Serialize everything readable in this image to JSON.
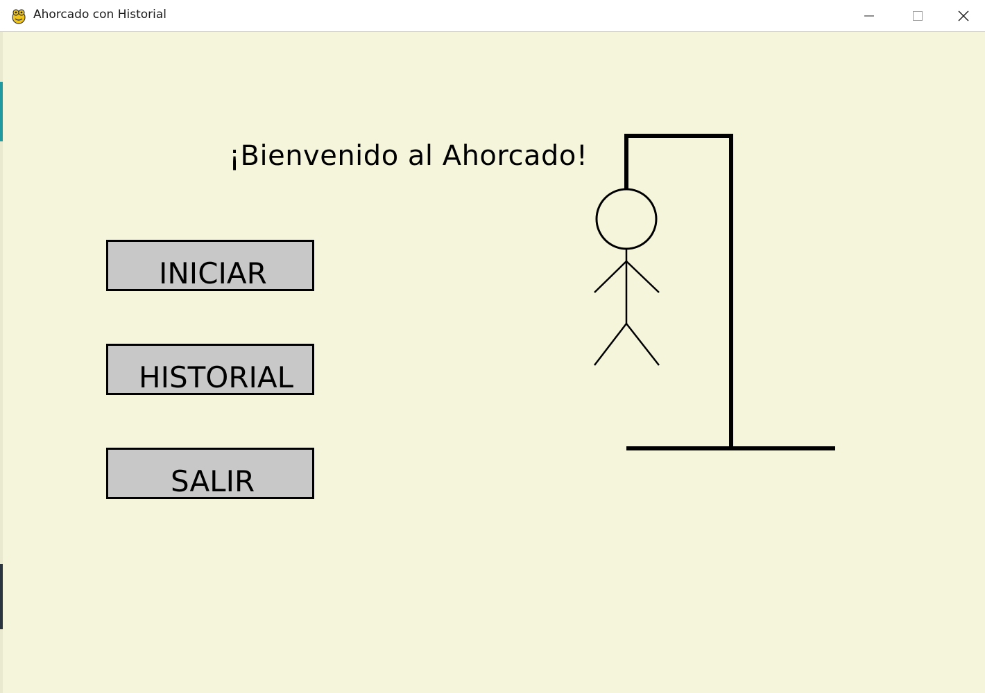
{
  "window": {
    "title": "Ahorcado con Historial",
    "app_icon": "pygame-snake-icon",
    "controls": {
      "minimize_icon": "minimize-icon",
      "maximize_icon": "maximize-icon",
      "close_icon": "close-icon"
    }
  },
  "screen": {
    "welcome_text": "¡Bienvenido al Ahorcado!",
    "buttons": {
      "start": "INICIAR",
      "history": "HISTORIAL",
      "exit": "SALIR"
    }
  },
  "illustration": {
    "name": "hangman-gallows",
    "figure": "stick-figure"
  },
  "colors": {
    "background": "#f5f5dc",
    "button_fill": "#c8c8c8",
    "button_border": "#000000",
    "drawing": "#000000"
  }
}
